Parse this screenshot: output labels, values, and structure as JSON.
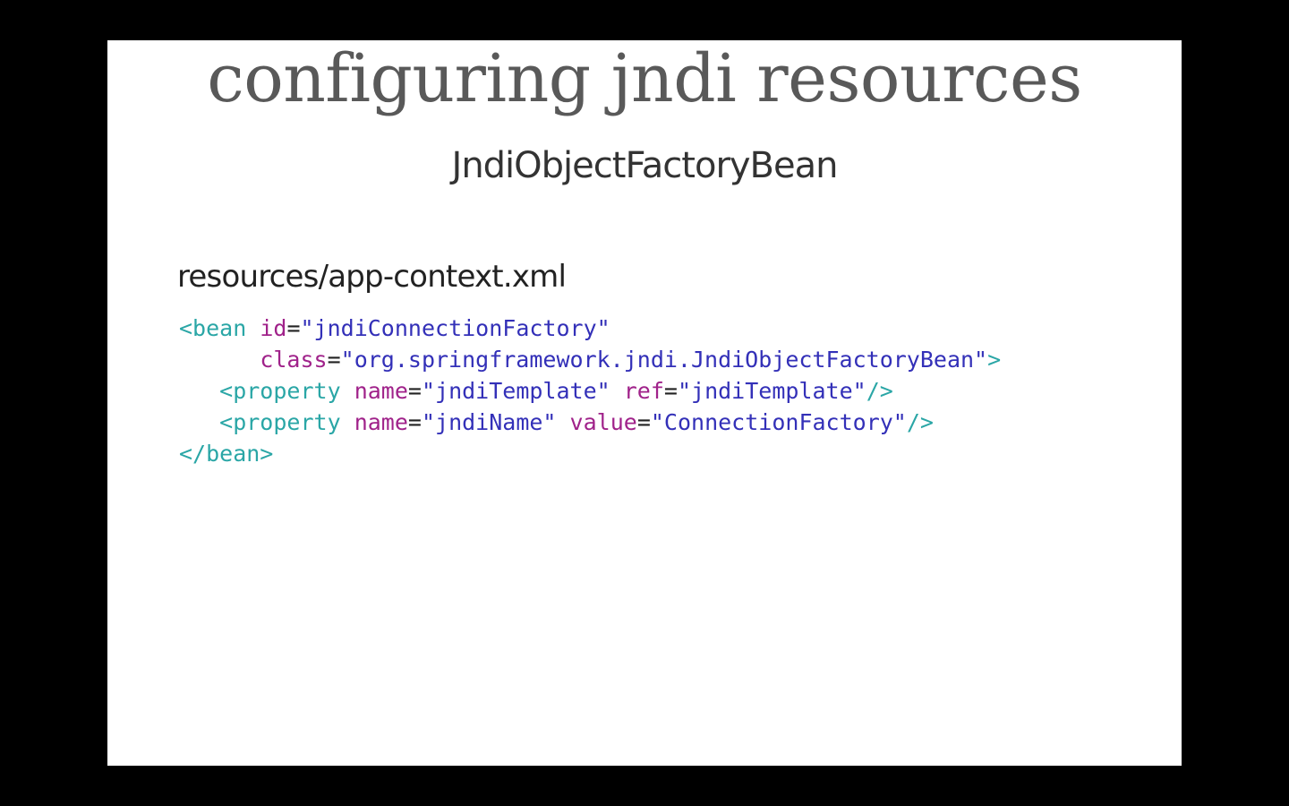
{
  "slide": {
    "title": "configuring jndi resources",
    "subtitle": "JndiObjectFactoryBean",
    "filename": "resources/app-context.xml"
  },
  "code": {
    "line1": {
      "open": "<bean",
      "attr_id": "id",
      "eq": "=",
      "val_id": "\"jndiConnectionFactory\""
    },
    "line2": {
      "indent": "      ",
      "attr_class": "class",
      "eq": "=",
      "val_class": "\"org.springframework.jndi.JndiObjectFactoryBean\"",
      "close": ">"
    },
    "line3": {
      "indent": "   ",
      "open": "<property",
      "attr_name": "name",
      "eq1": "=",
      "val_name": "\"jndiTemplate\"",
      "attr_ref": "ref",
      "eq2": "=",
      "val_ref": "\"jndiTemplate\"",
      "close": "/>"
    },
    "line4": {
      "indent": "   ",
      "open": "<property",
      "attr_name": "name",
      "eq1": "=",
      "val_name": "\"jndiName\"",
      "attr_value": "value",
      "eq2": "=",
      "val_value": "\"ConnectionFactory\"",
      "close": "/>"
    },
    "line5": {
      "close": "</bean>"
    }
  },
  "colors": {
    "tag": "#2aa6a6",
    "attribute": "#a0228a",
    "string": "#3330b8",
    "background": "#ffffff",
    "letterbox": "#000000"
  }
}
